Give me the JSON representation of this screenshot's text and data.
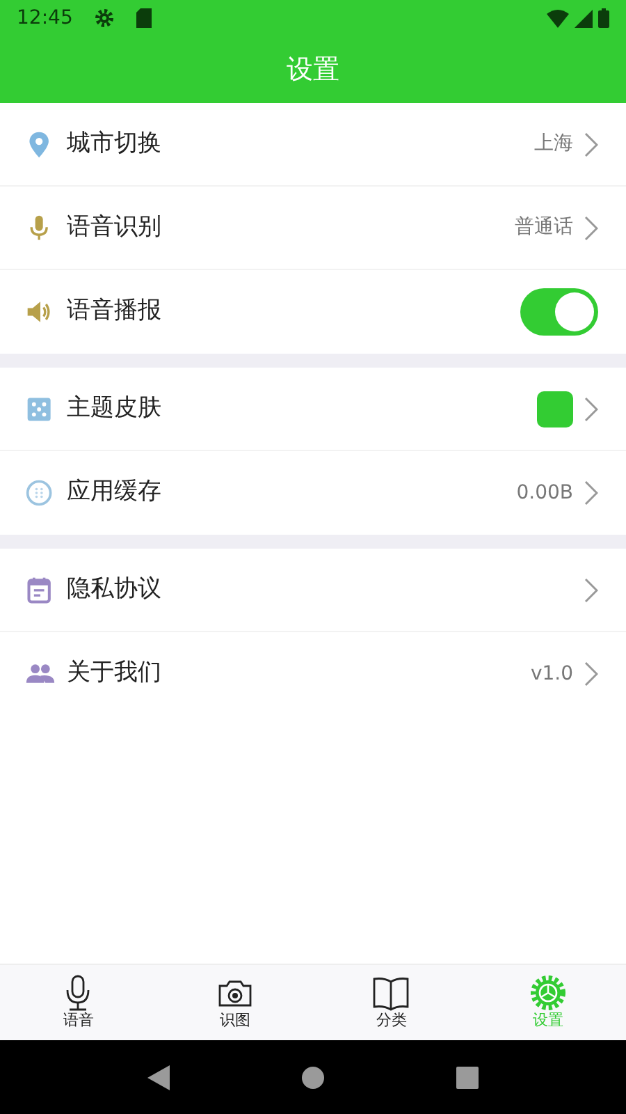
{
  "status_bar": {
    "time": "12:45"
  },
  "title": "设置",
  "groups": [
    [
      {
        "kind": "nav",
        "label": "城市切换",
        "value": "上海"
      },
      {
        "kind": "nav",
        "label": "语音识别",
        "value": "普通话"
      },
      {
        "kind": "toggle",
        "label": "语音播报",
        "on": true
      }
    ],
    [
      {
        "kind": "swatch",
        "label": "主题皮肤",
        "color": "#33cc33"
      },
      {
        "kind": "nav",
        "label": "应用缓存",
        "value": "0.00B"
      }
    ],
    [
      {
        "kind": "nav",
        "label": "隐私协议"
      },
      {
        "kind": "nav",
        "label": "关于我们",
        "value": "v1.0"
      }
    ]
  ],
  "tabs": [
    {
      "label": "语音",
      "selected": false
    },
    {
      "label": "识图",
      "selected": false
    },
    {
      "label": "分类",
      "selected": false
    },
    {
      "label": "设置",
      "selected": true
    }
  ]
}
